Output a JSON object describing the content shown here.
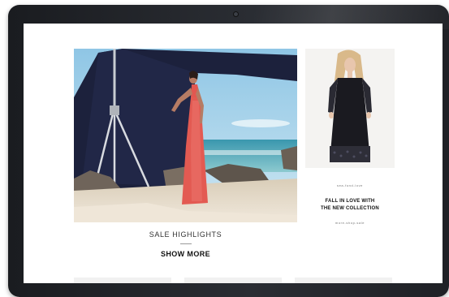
{
  "hero": {
    "sale_title": "SALE HIGHLIGHTS",
    "show_more_label": "SHOW MORE"
  },
  "side": {
    "badge_line1": "FALL IN LOVE WITH",
    "badge_line2": "THE NEW COLLECTION",
    "badge_arc_top": "sea-fund-love",
    "badge_arc_bottom": "more-shop-sale"
  },
  "colors": {
    "bezel": "#1f2126",
    "sky": "#a9d3ea",
    "sea": "#4fa7b7",
    "tarp": "#1b1f3a",
    "dress_red": "#e35a52",
    "sand": "#e6dccd",
    "black_dress": "#1a1a20"
  },
  "icons": {
    "camera": "webcam-dot"
  }
}
